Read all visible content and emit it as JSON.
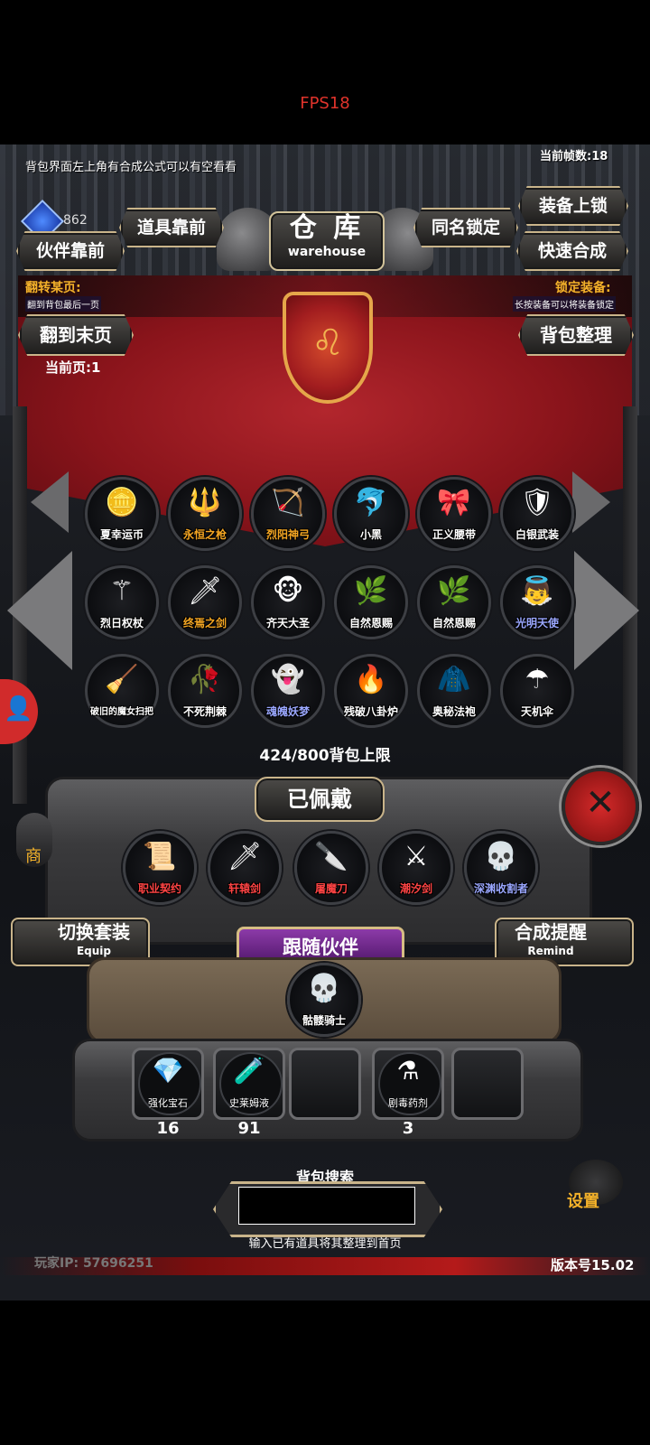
{
  "status": {
    "fps": "FPS18"
  },
  "top": {
    "hint": "背包界面左上角有合成公式可以有空看看",
    "frame_count": "当前帧数:18",
    "currency_value": "862"
  },
  "header": {
    "title_cn": "仓 库",
    "title_en": "warehouse",
    "btn_items_front": "道具靠前",
    "btn_partner_front": "伙伴靠前",
    "btn_same_name_lock": "同名锁定",
    "btn_equip_lock": "装备上锁",
    "btn_quick_craft": "快速合成"
  },
  "banner": {
    "flip_title": "翻转某页:",
    "flip_desc": "翻到背包最后一页",
    "lock_title": "锁定装备:",
    "lock_desc": "长按装备可以将装备锁定",
    "btn_last_page": "翻到末页",
    "btn_sort": "背包整理",
    "current_page": "当前页:1"
  },
  "inventory": {
    "items": [
      {
        "name": "夏幸运币",
        "icon": "🪙",
        "color": "#ffffff"
      },
      {
        "name": "永恒之枪",
        "icon": "🔱",
        "color": "#f4a623"
      },
      {
        "name": "烈阳神弓",
        "icon": "🏹",
        "color": "#f4a623"
      },
      {
        "name": "小黑",
        "icon": "🐬",
        "color": "#ffffff"
      },
      {
        "name": "正义腰带",
        "icon": "🎀",
        "color": "#ffffff"
      },
      {
        "name": "白银武装",
        "icon": "🛡",
        "color": "#ffffff"
      },
      {
        "name": "烈日权杖",
        "icon": "⚚",
        "color": "#ffffff"
      },
      {
        "name": "终焉之剑",
        "icon": "🗡",
        "color": "#f4a623"
      },
      {
        "name": "齐天大圣",
        "icon": "🐵",
        "color": "#ffffff"
      },
      {
        "name": "自然恩赐",
        "icon": "🌿",
        "color": "#ffffff"
      },
      {
        "name": "自然恩赐",
        "icon": "🌿",
        "color": "#ffffff"
      },
      {
        "name": "光明天使",
        "icon": "👼",
        "color": "#9aa7ff"
      },
      {
        "name": "破旧的魔女扫把",
        "icon": "🧹",
        "color": "#ffffff"
      },
      {
        "name": "不死荆棘",
        "icon": "🥀",
        "color": "#ffffff"
      },
      {
        "name": "魂魄妖梦",
        "icon": "👻",
        "color": "#9aa7ff"
      },
      {
        "name": "残破八卦炉",
        "icon": "🔥",
        "color": "#ffffff"
      },
      {
        "name": "奥秘法袍",
        "icon": "🧥",
        "color": "#ffffff"
      },
      {
        "name": "天机伞",
        "icon": "☂",
        "color": "#ffffff"
      }
    ],
    "capacity": "424/800背包上限"
  },
  "equipped": {
    "title": "已佩戴",
    "items": [
      {
        "name": "职业契约",
        "icon": "📜",
        "color": "#ff4444"
      },
      {
        "name": "轩辕剑",
        "icon": "🗡",
        "color": "#ff4444"
      },
      {
        "name": "屠魔刀",
        "icon": "🔪",
        "color": "#ff4444"
      },
      {
        "name": "潮汐剑",
        "icon": "⚔",
        "color": "#ff4444"
      },
      {
        "name": "深渊收割者",
        "icon": "💀",
        "color": "#9aa7ff"
      }
    ],
    "btn_switch_cn": "切换套装",
    "btn_switch_en": "Equip",
    "btn_remind_cn": "合成提醒",
    "btn_remind_en": "Remind"
  },
  "partner": {
    "title": "跟随伙伴",
    "name": "骷髅骑士",
    "icon": "💀"
  },
  "consumables": [
    {
      "name": "强化宝石",
      "icon": "💎",
      "count": "16"
    },
    {
      "name": "史莱姆液",
      "icon": "🧪",
      "count": "91"
    },
    {
      "name": "",
      "icon": "",
      "count": ""
    },
    {
      "name": "剧毒药剂",
      "icon": "⚗",
      "count": "3"
    },
    {
      "name": "",
      "icon": "",
      "count": ""
    }
  ],
  "search": {
    "title": "背包搜索",
    "hint": "输入已有道具将其整理到首页"
  },
  "footer": {
    "player_ip": "玩家IP: 57696251",
    "version": "版本号15.02"
  },
  "side": {
    "shop": "商",
    "settings": "设置"
  }
}
